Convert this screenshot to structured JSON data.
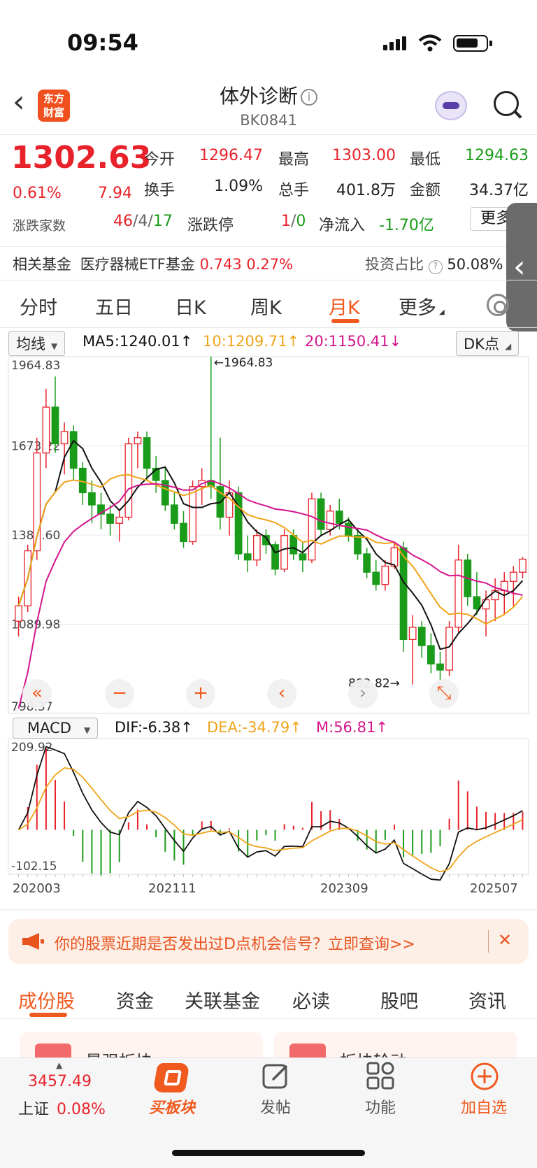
{
  "status": {
    "time": "09:54"
  },
  "header": {
    "logo_line1": "东方",
    "logo_line2": "财富",
    "title": "体外诊断",
    "info_symbol": "i",
    "code": "BK0841"
  },
  "quote": {
    "price": "1302.63",
    "change_pct": "0.61%",
    "change": "7.94",
    "rows": [
      [
        {
          "label": "今开",
          "value": "1296.47",
          "color": "red"
        },
        {
          "label": "最高",
          "value": "1303.00",
          "color": "red"
        },
        {
          "label": "最低",
          "value": "1294.63",
          "color": "green"
        }
      ],
      [
        {
          "label": "换手",
          "value": "1.09%",
          "color": "black"
        },
        {
          "label": "总手",
          "value": "401.8万",
          "color": "black"
        },
        {
          "label": "金额",
          "value": "34.37亿",
          "color": "black"
        }
      ]
    ],
    "updown_label": "涨跌家数",
    "up_count": "46",
    "flat_count": "4",
    "down_count": "17",
    "limit_label": "涨跌停",
    "limit_up": "1",
    "limit_down": "0",
    "netflow_label": "净流入",
    "netflow_value": "-1.70亿",
    "more_label": "更多",
    "fund_label": "相关基金",
    "fund_name": "医疗器械ETF基金",
    "fund_price": "0.743",
    "fund_pct": "0.27%",
    "invest_label": "投资占比",
    "invest_q": "?",
    "invest_value": "50.08%"
  },
  "ktabs": {
    "items": [
      "分时",
      "五日",
      "日K",
      "周K",
      "月K",
      "更多"
    ],
    "active_index": 4
  },
  "ma_row": {
    "selector": "均线",
    "ma5": "MA5:1240.01",
    "ma10": "10:1209.71",
    "ma20": "20:1150.41",
    "dk": "DK点",
    "colors": {
      "ma5": "#111111",
      "ma10": "#f0a419",
      "ma20": "#d4148c"
    }
  },
  "main_chart": {
    "y_labels": [
      "1964.83",
      "1673.22",
      "1381.60",
      "1089.98",
      "798.37"
    ],
    "max_marker": "1964.83",
    "min_marker": "892.82",
    "controls": [
      "«",
      "−",
      "+",
      "‹",
      "›",
      "⤡"
    ]
  },
  "macd_row": {
    "selector": "MACD",
    "dif": "DIF:-6.38",
    "dea": "DEA:-34.79",
    "m": "M:56.81",
    "colors": {
      "dif": "#111111",
      "dea": "#f0a419",
      "m": "#d4148c"
    }
  },
  "macd_chart": {
    "y_top": "209.92",
    "y_bottom": "-102.15",
    "x_labels": [
      "202003",
      "202111",
      "202309",
      "202507"
    ]
  },
  "chart_data": {
    "type": "candlestick",
    "period": "monthly",
    "x_range": [
      "202003",
      "202507"
    ],
    "y_ticks": [
      1964.83,
      1673.22,
      1381.6,
      1089.98,
      798.37
    ],
    "highest": 1964.83,
    "lowest": 892.82,
    "ohlc_approx": [
      [
        1100,
        1180,
        1050,
        1150
      ],
      [
        1150,
        1350,
        1130,
        1330
      ],
      [
        1330,
        1700,
        1300,
        1650
      ],
      [
        1650,
        1860,
        1600,
        1800
      ],
      [
        1800,
        1900,
        1650,
        1680
      ],
      [
        1680,
        1750,
        1580,
        1720
      ],
      [
        1720,
        1740,
        1560,
        1600
      ],
      [
        1600,
        1620,
        1480,
        1520
      ],
      [
        1520,
        1560,
        1420,
        1480
      ],
      [
        1480,
        1520,
        1400,
        1450
      ],
      [
        1450,
        1480,
        1380,
        1420
      ],
      [
        1420,
        1460,
        1360,
        1440
      ],
      [
        1440,
        1700,
        1430,
        1680
      ],
      [
        1680,
        1720,
        1600,
        1700
      ],
      [
        1700,
        1720,
        1560,
        1600
      ],
      [
        1600,
        1640,
        1520,
        1560
      ],
      [
        1560,
        1600,
        1460,
        1480
      ],
      [
        1480,
        1520,
        1400,
        1420
      ],
      [
        1420,
        1460,
        1340,
        1360
      ],
      [
        1360,
        1560,
        1350,
        1540
      ],
      [
        1540,
        1600,
        1480,
        1560
      ],
      [
        1560,
        1964.83,
        1500,
        1540
      ],
      [
        1540,
        1700,
        1400,
        1440
      ],
      [
        1440,
        1560,
        1380,
        1520
      ],
      [
        1520,
        1540,
        1300,
        1320
      ],
      [
        1320,
        1380,
        1260,
        1300
      ],
      [
        1300,
        1400,
        1280,
        1380
      ],
      [
        1380,
        1400,
        1320,
        1350
      ],
      [
        1350,
        1360,
        1250,
        1270
      ],
      [
        1270,
        1400,
        1260,
        1380
      ],
      [
        1380,
        1400,
        1300,
        1320
      ],
      [
        1320,
        1360,
        1260,
        1300
      ],
      [
        1300,
        1520,
        1290,
        1500
      ],
      [
        1500,
        1520,
        1380,
        1400
      ],
      [
        1400,
        1480,
        1380,
        1460
      ],
      [
        1460,
        1500,
        1400,
        1420
      ],
      [
        1420,
        1440,
        1360,
        1380
      ],
      [
        1380,
        1400,
        1300,
        1320
      ],
      [
        1320,
        1340,
        1240,
        1260
      ],
      [
        1260,
        1300,
        1200,
        1220
      ],
      [
        1220,
        1300,
        1200,
        1280
      ],
      [
        1280,
        1360,
        1270,
        1340
      ],
      [
        1340,
        1360,
        1000,
        1040
      ],
      [
        1040,
        1120,
        892.82,
        1080
      ],
      [
        1080,
        1100,
        980,
        1020
      ],
      [
        1020,
        1060,
        930,
        960
      ],
      [
        960,
        1000,
        900,
        940
      ],
      [
        940,
        1100,
        920,
        1080
      ],
      [
        1080,
        1350,
        1060,
        1300
      ],
      [
        1300,
        1320,
        1150,
        1180
      ],
      [
        1180,
        1260,
        1120,
        1140
      ],
      [
        1140,
        1200,
        1050,
        1170
      ],
      [
        1170,
        1240,
        1100,
        1200
      ],
      [
        1200,
        1260,
        1120,
        1230
      ],
      [
        1230,
        1280,
        1150,
        1260
      ],
      [
        1260,
        1310,
        1240,
        1302.63
      ]
    ],
    "ma5_last": 1240.01,
    "ma10_last": 1209.71,
    "ma20_last": 1150.41,
    "macd": {
      "dif": -6.38,
      "dea": -34.79,
      "m": 56.81,
      "y_range": [
        -102.15,
        209.92
      ]
    }
  },
  "banner": {
    "text": "你的股票近期是否发出过D点机会信号？立即查询>>",
    "close": "✕"
  },
  "btabs": {
    "items": [
      "成份股",
      "资金",
      "关联基金",
      "必读",
      "股吧",
      "资讯"
    ],
    "active_index": 0
  },
  "cards": {
    "left": "最强板块",
    "right": "板块轮动"
  },
  "bottom_nav": {
    "index_value": "3457.49",
    "index_name": "上证",
    "index_pct": "0.08%",
    "buy_label": "买板块",
    "post_label": "发帖",
    "func_label": "功能",
    "add_label": "加自选"
  }
}
